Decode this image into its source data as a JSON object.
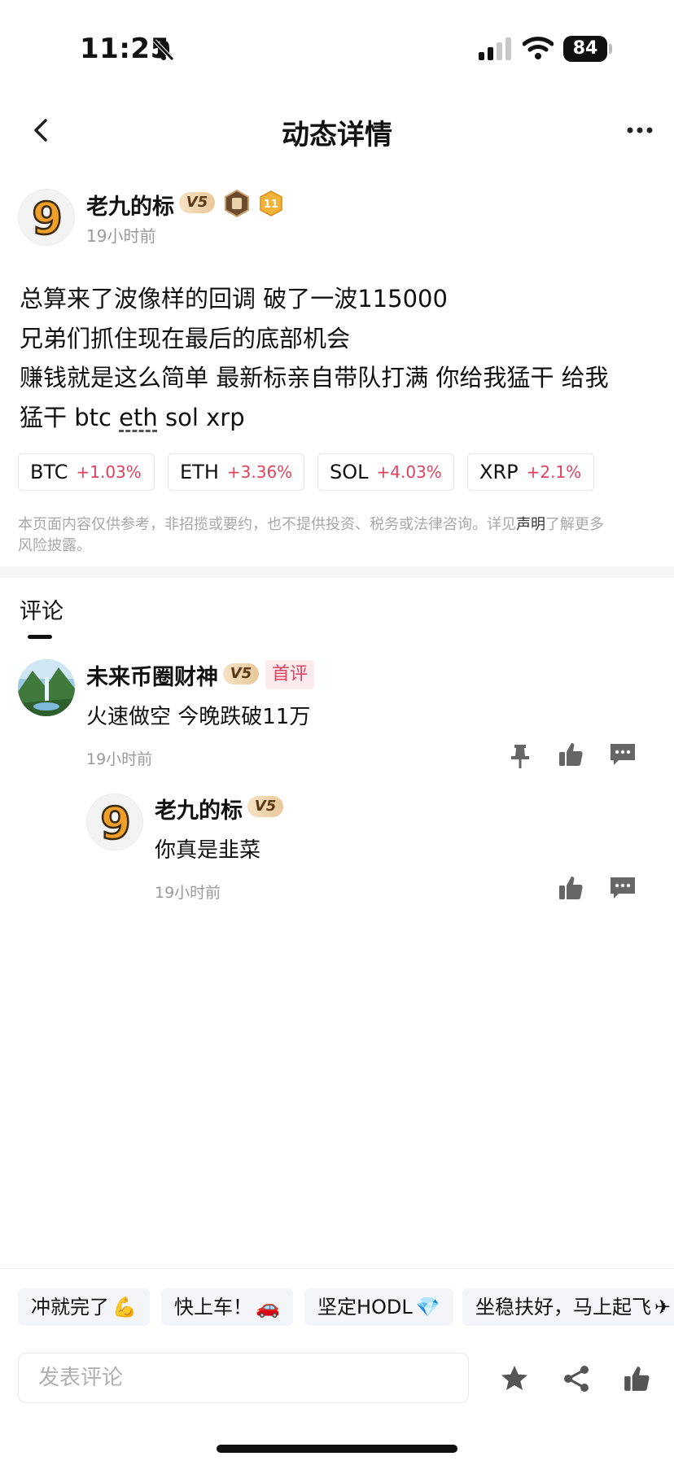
{
  "status_bar": {
    "time": "11:25",
    "battery": "84"
  },
  "nav": {
    "title": "动态详情"
  },
  "post": {
    "author": "老九的标",
    "level": "V5",
    "rank_number": "11",
    "avatar_glyph": "9",
    "time": "19小时前",
    "lines": [
      "总算来了波像样的回调 破了一波115000",
      "兄弟们抓住现在最后的底部机会",
      "赚钱就是这么简单 最新标亲自带队打满 你给我猛干 给我"
    ],
    "last_line_prefix": "猛干 btc ",
    "last_line_eth": "eth",
    "last_line_suffix": " sol xrp",
    "tickers": [
      {
        "symbol": "BTC",
        "change": "+1.03%"
      },
      {
        "symbol": "ETH",
        "change": "+3.36%"
      },
      {
        "symbol": "SOL",
        "change": "+4.03%"
      },
      {
        "symbol": "XRP",
        "change": "+2.1%"
      }
    ],
    "disclaimer_before": "本页面内容仅供参考，非招揽或要约，也不提供投资、税务或法律咨询。详见",
    "disclaimer_link": "声明",
    "disclaimer_after": "了解更多",
    "disclaimer_line2": "风险披露。"
  },
  "comments": {
    "title": "评论",
    "items": [
      {
        "author": "未来币圈财神",
        "level": "V5",
        "tag": "首评",
        "text": "火速做空 今晚跌破11万",
        "time": "19小时前"
      }
    ],
    "reply": {
      "author": "老九的标",
      "level": "V5",
      "avatar_glyph": "9",
      "text": "你真是韭菜",
      "time": "19小时前"
    }
  },
  "quick_replies": [
    {
      "text": "冲就完了",
      "emoji": "💪"
    },
    {
      "text": "快上车！",
      "emoji": "🚗"
    },
    {
      "text": "坚定HODL",
      "emoji": "💎"
    },
    {
      "text": "坐稳扶好，马上起飞",
      "emoji": "✈"
    }
  ],
  "input": {
    "placeholder": "发表评论"
  },
  "colors": {
    "up": "#e0425e",
    "level_badge": "#e9c89a"
  }
}
